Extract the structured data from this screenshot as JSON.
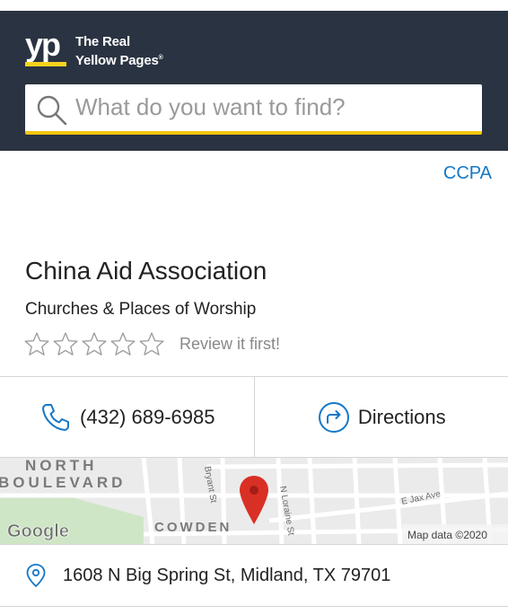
{
  "header": {
    "logo_mark": "yp",
    "logo_line1": "The Real",
    "logo_line2": "Yellow Pages",
    "logo_trademark": "®",
    "bg_color": "#2a3341",
    "accent_color": "#f6c610"
  },
  "search": {
    "placeholder": "What do you want to find?",
    "value": ""
  },
  "links": {
    "ccpa": "CCPA"
  },
  "business": {
    "name": "China Aid Association",
    "category": "Churches & Places of Worship",
    "rating": 0,
    "max_rating": 5,
    "review_prompt": "Review it first!"
  },
  "actions": {
    "phone": "(432) 689-6985",
    "directions": "Directions",
    "icon_color": "#1478c8"
  },
  "map": {
    "labels": {
      "north": "NORTH",
      "boulevard": "BOULEVARD",
      "bryant": "Bryant St",
      "loraine": "N Loraine St",
      "jax": "E Jax Ave",
      "cowden": "COWDEN",
      "attribution_brand": "Google",
      "attribution": "Map data ©2020"
    },
    "marker_color": "#d93025"
  },
  "address": {
    "text": "1608 N Big Spring St, Midland, TX 79701"
  }
}
